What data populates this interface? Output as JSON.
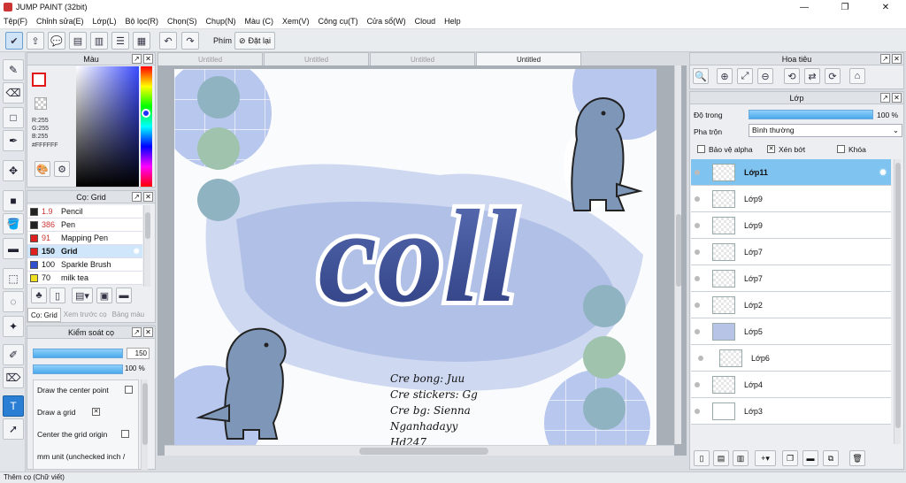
{
  "window": {
    "title": "JUMP PAINT (32bit)",
    "min": "—",
    "max": "❐",
    "close": "✕"
  },
  "menu": [
    "Tệp(F)",
    "Chỉnh sửa(E)",
    "Lớp(L)",
    "Bộ lọc(R)",
    "Chọn(S)",
    "Chụp(N)",
    "Màu (C)",
    "Xem(V)",
    "Công cụ(T)",
    "Cửa sổ(W)",
    "Cloud",
    "Help"
  ],
  "toolbar": {
    "phim_label": "Phím",
    "reset_label": "Đặt lại"
  },
  "color_panel": {
    "title": "Màu",
    "r": "R:255",
    "g": "G:255",
    "b": "B:255",
    "hex": "#FFFFFF",
    "foreground": "#ffffff",
    "accent": "#e01818"
  },
  "brush_panel": {
    "title": "Cọ: Grid",
    "items": [
      {
        "size": "1.9",
        "name": "Pencil",
        "color": "#222222"
      },
      {
        "size": "386",
        "name": "Pen",
        "color": "#222222"
      },
      {
        "size": "91",
        "name": "Mapping Pen",
        "color": "#e02020"
      },
      {
        "size": "150",
        "name": "Grid",
        "color": "#e02020"
      },
      {
        "size": "100",
        "name": "Sparkle Brush",
        "color": "#3050d0"
      },
      {
        "size": "70",
        "name": "milk tea",
        "color": "#f0e020"
      }
    ],
    "tab_active": "Cọ: Grid",
    "tab_preview": "Xem trước cọ",
    "tab_palette": "Bảng màu"
  },
  "brush_control": {
    "title": "Kiểm soát cọ",
    "size_value": "150",
    "opacity_value": "100 %",
    "opt_center_point": "Draw the center point",
    "opt_draw_grid": "Draw a grid",
    "opt_center_origin": "Center the grid origin",
    "opt_mm_unit": "mm unit (unchecked inch /"
  },
  "doc_tabs": [
    "Untitled",
    "Untitled",
    "Untitled",
    "Untitled"
  ],
  "artwork": {
    "word": "coll",
    "credits": [
      "Cre bong: Juu",
      "Cre stickers: Gg",
      "Cre bg: Sienna",
      "Nganhadayy",
      "Hd247"
    ]
  },
  "navigator": {
    "title": "Hoa tiêu"
  },
  "layers_panel": {
    "title": "Lớp",
    "opacity_label": "Độ trong",
    "opacity_value": "100 %",
    "blend_label": "Pha trộn",
    "blend_value": "Bình thường",
    "protect_alpha": "Bảo vệ alpha",
    "clipping": "Xén bớt",
    "lock": "Khóa",
    "layers": [
      "Lớp11",
      "Lớp9",
      "Lớp9",
      "Lớp7",
      "Lớp7",
      "Lớp2",
      "Lớp5",
      "Lớp6",
      "Lớp4",
      "Lớp3"
    ]
  },
  "status": {
    "text": "Thêm cọ (Chữ viết)"
  }
}
